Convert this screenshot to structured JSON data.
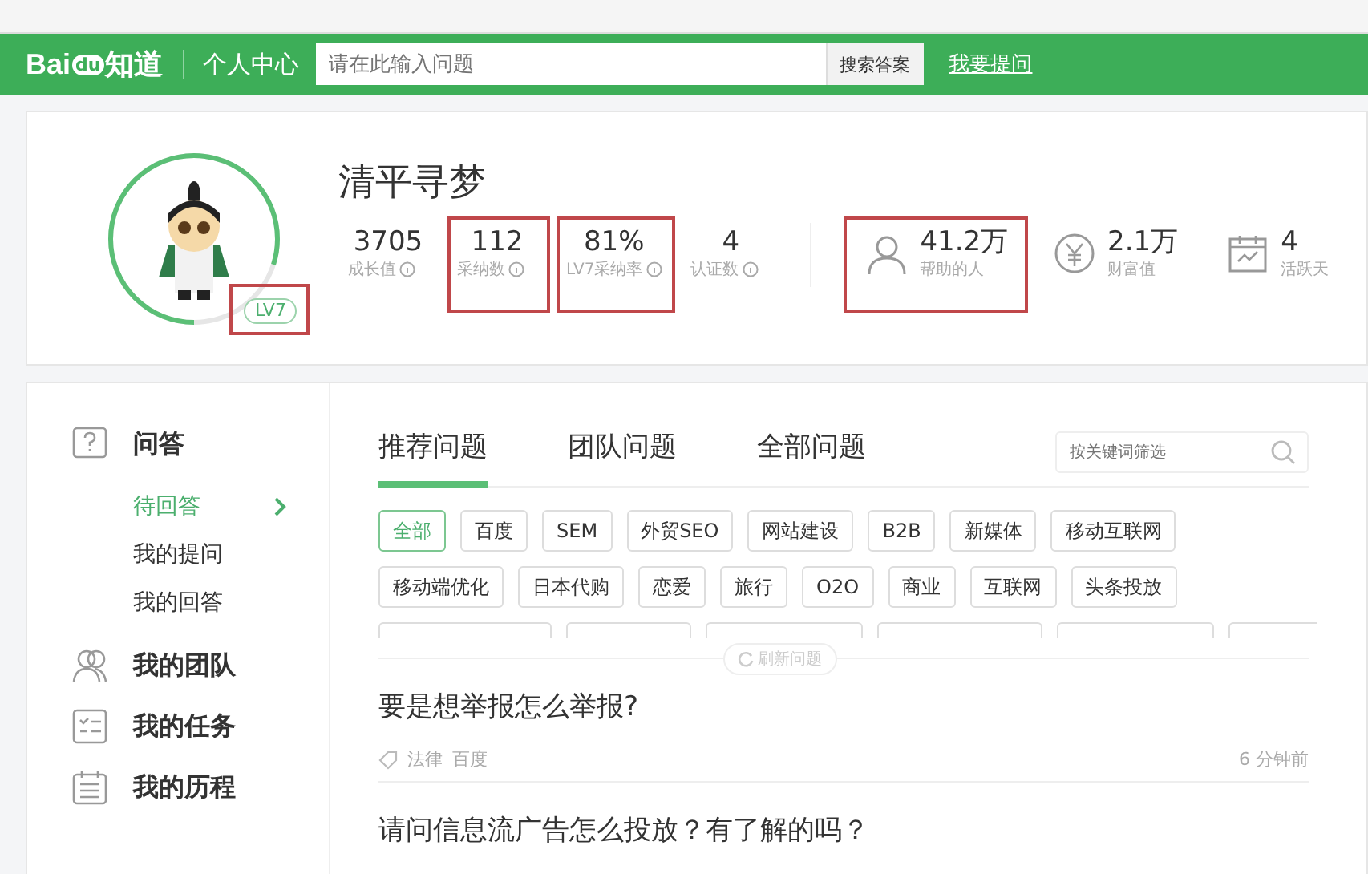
{
  "header": {
    "logo": "Bai",
    "logo_paw": "du",
    "logo_suffix": "知道",
    "section": "个人中心",
    "search": {
      "placeholder": "请在此输入问题"
    },
    "search_button": "搜索答案",
    "ask_link": "我要提问"
  },
  "profile": {
    "name": "清平寻梦",
    "level_badge": "LV7",
    "level_highlighted": true,
    "level": 0.8,
    "stats": [
      {
        "value": "3705",
        "label": "成长值",
        "info": true,
        "highlighted": false
      },
      {
        "value": "112",
        "label": "采纳数",
        "info": true,
        "highlighted": true
      },
      {
        "value": "81%",
        "label": "LV7采纳率",
        "info": true,
        "highlighted": true
      },
      {
        "value": "4",
        "label": "认证数",
        "info": true,
        "highlighted": false
      }
    ],
    "metrics": [
      {
        "kind": "person",
        "value": "41.2万",
        "label": "帮助的人",
        "highlighted": true
      },
      {
        "kind": "yen",
        "value": "2.1万",
        "label": "财富值",
        "highlighted": false
      },
      {
        "kind": "calendar",
        "value": "4",
        "label": "活跃天",
        "highlighted": false
      }
    ]
  },
  "sidebar": {
    "sections": [
      {
        "kind": "question",
        "label": "问答",
        "items": [
          {
            "label": "待回答",
            "selected": true
          },
          {
            "label": "我的提问",
            "selected": false
          },
          {
            "label": "我的回答",
            "selected": false
          }
        ]
      },
      {
        "kind": "team",
        "label": "我的团队"
      },
      {
        "kind": "tasks",
        "label": "我的任务"
      },
      {
        "kind": "history",
        "label": "我的历程"
      }
    ]
  },
  "tabs": [
    {
      "label": "推荐问题",
      "selected": true
    },
    {
      "label": "团队问题",
      "selected": false
    },
    {
      "label": "全部问题",
      "selected": false
    }
  ],
  "filter": {
    "placeholder": "按关键词筛选"
  },
  "tags": [
    [
      {
        "label": "全部",
        "selected": true
      },
      {
        "label": "百度",
        "selected": false
      },
      {
        "label": "SEM",
        "selected": false
      },
      {
        "label": "外贸SEO",
        "selected": false
      },
      {
        "label": "网站建设",
        "selected": false
      },
      {
        "label": "B2B",
        "selected": false
      },
      {
        "label": "新媒体",
        "selected": false
      },
      {
        "label": "移动互联网",
        "selected": false
      }
    ],
    [
      {
        "label": "移动端优化",
        "selected": false
      },
      {
        "label": "日本代购",
        "selected": false
      },
      {
        "label": "恋爱",
        "selected": false
      },
      {
        "label": "旅行",
        "selected": false
      },
      {
        "label": "O2O",
        "selected": false
      },
      {
        "label": "商业",
        "selected": false
      },
      {
        "label": "互联网",
        "selected": false
      },
      {
        "label": "头条投放",
        "selected": false
      }
    ]
  ],
  "refresh": "刷新问题",
  "questions": [
    {
      "title": "要是想举报怎么举报?",
      "tags": [
        "法律",
        "百度"
      ],
      "time": "6 分钟前"
    },
    {
      "title": "请问信息流广告怎么投放？有了解的吗？"
    }
  ]
}
